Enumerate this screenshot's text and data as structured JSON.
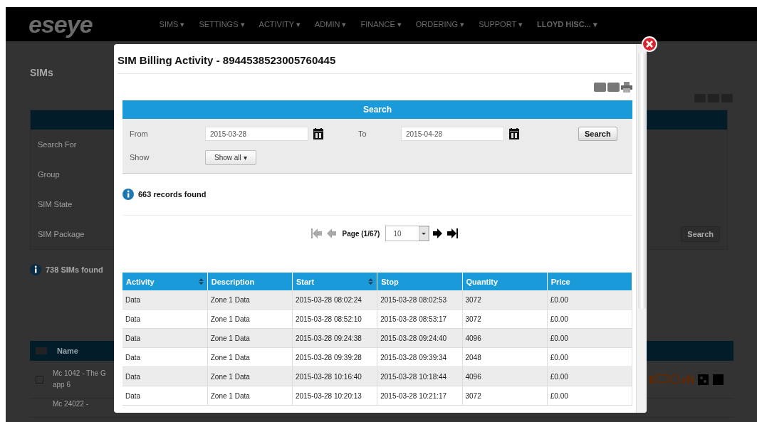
{
  "nav": {
    "logo": "eseye",
    "items": [
      "SIMS ▾",
      "SETTINGS ▾",
      "ACTIVITY ▾",
      "ADMIN ▾",
      "FINANCE ▾",
      "ORDERING ▾",
      "SUPPORT ▾",
      "LLOYD HISC... ▾"
    ]
  },
  "page": {
    "title": "SIMs",
    "filters": [
      "Search For",
      "Group",
      "SIM State",
      "SIM Package"
    ],
    "search_button": "Search",
    "found": "738 SIMs found",
    "table_header": "Name",
    "header_checked": false,
    "rows": [
      {
        "name": "Mc 1042 - The G",
        "name_2": "app 6",
        "checked": false
      },
      {
        "name": "Mc 24022 -"
      }
    ]
  },
  "dialog": {
    "title": "SIM Billing Activity - 8944538523005760445",
    "search": {
      "title": "Search",
      "from_label": "From",
      "from_value": "2015-03-28",
      "to_label": "To",
      "to_value": "2015-04-28",
      "button": "Search",
      "show_label": "Show",
      "show_value": "Show all ▾"
    },
    "info": "663 records found",
    "pager": {
      "page": "Page (1/67)",
      "page_size": "10"
    },
    "columns": [
      {
        "label": "Activity",
        "sortable": true
      },
      {
        "label": "Description",
        "sortable": false
      },
      {
        "label": "Start",
        "sortable": true
      },
      {
        "label": "Stop",
        "sortable": false
      },
      {
        "label": "Quantity",
        "sortable": false
      },
      {
        "label": "Price",
        "sortable": false
      }
    ],
    "rows": [
      [
        "Data",
        "Zone 1 Data",
        "2015-03-28 08:02:24",
        "2015-03-28 08:02:53",
        "3072",
        "£0.00"
      ],
      [
        "Data",
        "Zone 1 Data",
        "2015-03-28 08:52:10",
        "2015-03-28 08:53:17",
        "3072",
        "£0.00"
      ],
      [
        "Data",
        "Zone 1 Data",
        "2015-03-28 09:24:38",
        "2015-03-28 09:24:40",
        "4096",
        "£0.00"
      ],
      [
        "Data",
        "Zone 1 Data",
        "2015-03-28 09:39:28",
        "2015-03-28 09:39:34",
        "2048",
        "£0.00"
      ],
      [
        "Data",
        "Zone 1 Data",
        "2015-03-28 10:16:40",
        "2015-03-28 10:18:44",
        "4096",
        "£0.00"
      ],
      [
        "Data",
        "Zone 1 Data",
        "2015-03-28 10:20:13",
        "2015-03-28 10:21:17",
        "3072",
        "£0.00"
      ]
    ]
  }
}
